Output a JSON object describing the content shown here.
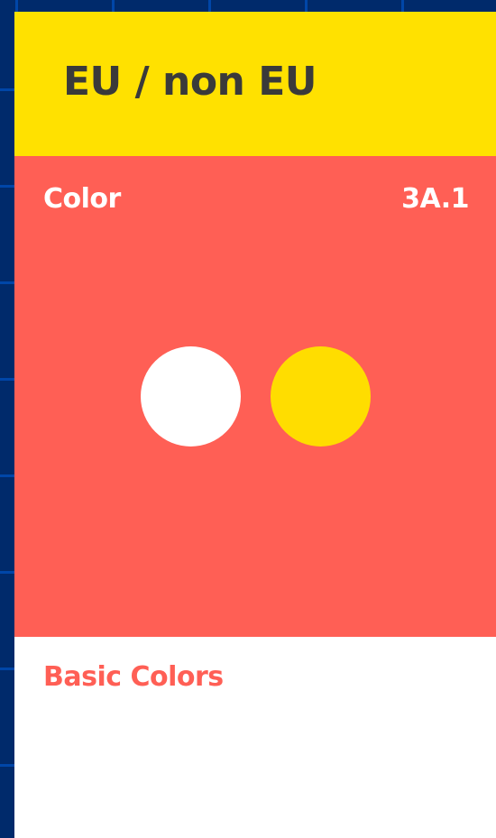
{
  "header": {
    "title": "EU / non EU"
  },
  "panel": {
    "label": "Color",
    "code": "3A.1",
    "background": "#FF5F55"
  },
  "swatches": [
    {
      "name": "white",
      "color": "#FFFFFF"
    },
    {
      "name": "yellow",
      "color": "#FFDD00"
    }
  ],
  "footer": {
    "title": "Basic Colors"
  },
  "colors": {
    "page_background": "#002A6B",
    "grid_lines": "#0046A8",
    "header_background": "#FFE100",
    "header_text": "#3A3A3A",
    "accent": "#FF5F55",
    "footer_background": "#FFFFFF"
  }
}
